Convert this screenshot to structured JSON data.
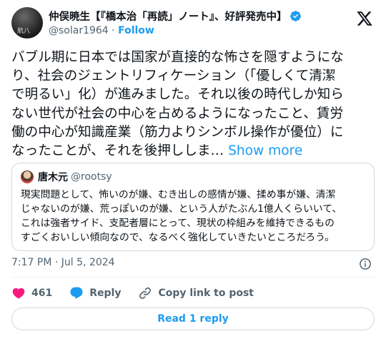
{
  "author": {
    "display_name": "仲俣暁生【『橋本治「再読」ノート』、好評発売中】",
    "handle": "@solar1964",
    "separator": "·",
    "follow_label": "Follow",
    "avatar_mark": "航八"
  },
  "tweet": {
    "lines": [
      "バブル期に日本では国家が直接的な怖さを隠すようにな",
      "り、社会のジェントリフィケーション（「優しくて清潔",
      "で明るい」化）が進みました。それ以後の時代しか知ら",
      "ない世代が社会の中心を占めるようになったこと、賃労",
      "働の中心が知識産業（筋力よりシンボル操作が優位）に",
      "なったことが、それを後押ししま…"
    ],
    "show_more_label": "Show more"
  },
  "quote": {
    "name": "唐木元",
    "handle": "@rootsy",
    "lines": [
      "現実問題として、怖いのが嫌、むき出しの感情が嫌、揉め事が嫌、清潔",
      "じゃないのが嫌、荒っぽいのが嫌、という人がたぶん1億人くらいいて、",
      "これは強者サイド、支配者層にとって、現状の枠組みを維持できるもの",
      "すごくおいしい傾向なので、なるべく強化していきたいところだろう。"
    ]
  },
  "meta": {
    "timestamp": "7:17 PM · Jul 5, 2024"
  },
  "actions": {
    "like_count": "461",
    "reply_label": "Reply",
    "copy_link_label": "Copy link to post"
  },
  "read_replies_label": "Read 1 reply",
  "colors": {
    "accent": "#1d9bf0",
    "like": "#f91880",
    "muted": "#536471",
    "border": "#cfd9de"
  }
}
